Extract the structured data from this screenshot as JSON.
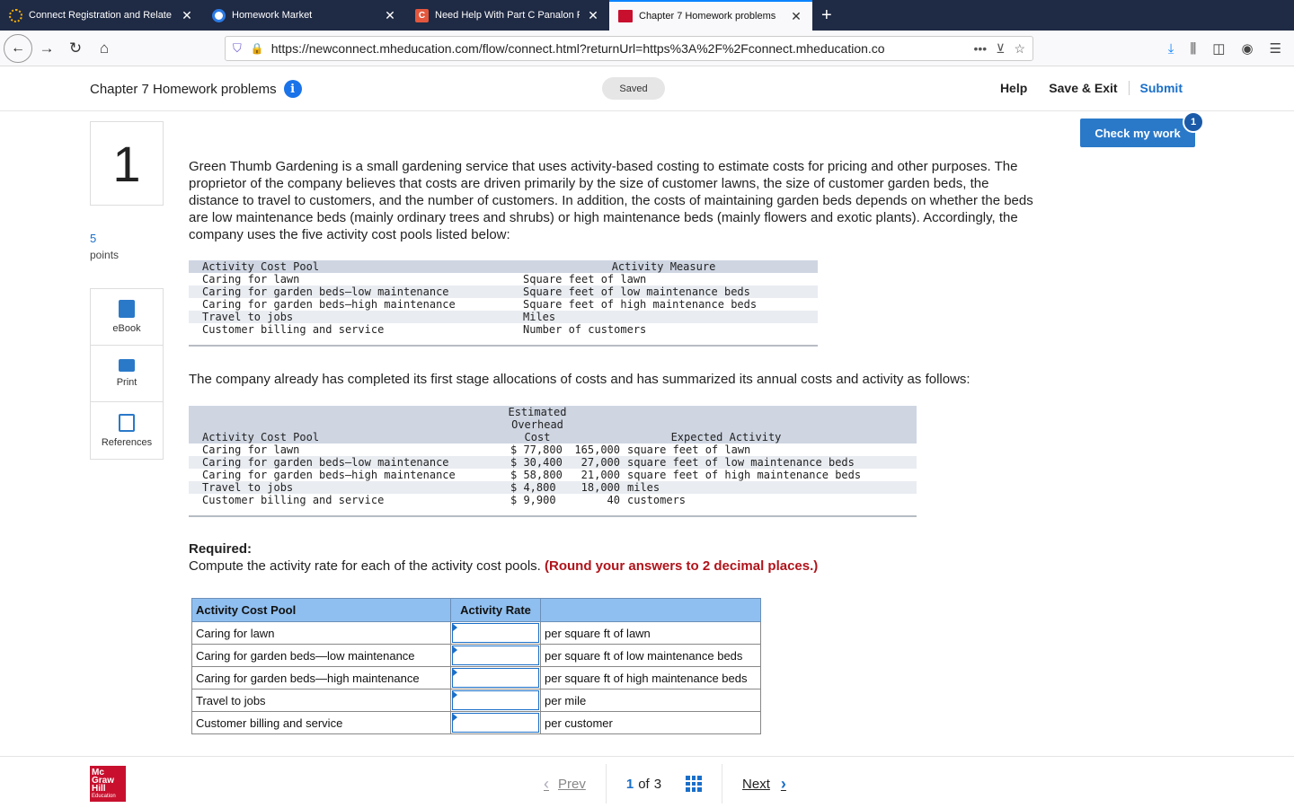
{
  "browser": {
    "tabs": [
      {
        "title": "Connect Registration and Relate",
        "active": false
      },
      {
        "title": "Homework Market",
        "active": false
      },
      {
        "title": "Need Help With Part C Panalon F",
        "active": false
      },
      {
        "title": "Chapter 7 Homework problems",
        "active": true
      }
    ],
    "new_tab": "+",
    "url": "https://newconnect.mheducation.com/flow/connect.html?returnUrl=https%3A%2F%2Fconnect.mheducation.co",
    "url_actions": "•••",
    "colors": {
      "tabstrip": "#1f2a44",
      "accent": "#0a84ff"
    }
  },
  "header": {
    "title": "Chapter 7 Homework problems",
    "info_icon": "i",
    "saved": "Saved",
    "help": "Help",
    "save_exit": "Save & Exit",
    "submit": "Submit",
    "check_my_work": "Check my work",
    "check_badge": "1"
  },
  "question": {
    "number": "1",
    "points_value": "5",
    "points_label": "points",
    "tools": [
      {
        "label": "eBook",
        "icon": "book-icon"
      },
      {
        "label": "Print",
        "icon": "print-icon"
      },
      {
        "label": "References",
        "icon": "references-icon"
      }
    ]
  },
  "content": {
    "intro": "Green Thumb Gardening is a small gardening service that uses activity-based costing to estimate costs for pricing and other purposes. The proprietor of the company believes that costs are driven primarily by the size of customer lawns, the size of customer garden beds, the distance to travel to customers, and the number of customers. In addition, the costs of maintaining garden beds depends on whether the beds are low maintenance beds (mainly ordinary trees and shrubs) or high maintenance beds (mainly flowers and exotic plants). Accordingly, the company uses the five activity cost pools listed below:",
    "pools_table": {
      "headers": [
        "Activity Cost Pool",
        "Activity Measure"
      ],
      "rows": [
        [
          "Caring for lawn",
          "Square feet of lawn"
        ],
        [
          "Caring for garden beds–low maintenance",
          "Square feet of low maintenance beds"
        ],
        [
          "Caring for garden beds–high maintenance",
          "Square feet of high maintenance beds"
        ],
        [
          "Travel to jobs",
          "Miles"
        ],
        [
          "Customer billing and service",
          "Number of customers"
        ]
      ]
    },
    "mid_text": "The company already has completed its first stage allocations of costs and has summarized its annual costs and activity as follows:",
    "cost_table": {
      "header_lines": [
        "Estimated",
        "Overhead",
        "Cost"
      ],
      "col1_header": "Activity Cost Pool",
      "col3_header": "Expected Activity",
      "rows": [
        [
          "Caring for lawn",
          "$ 77,800",
          "165,000",
          "square feet of lawn"
        ],
        [
          "Caring for garden beds–low maintenance",
          "$ 30,400",
          "27,000",
          "square feet of low maintenance beds"
        ],
        [
          "Caring for garden beds–high maintenance",
          "$ 58,800",
          "21,000",
          "square feet of high maintenance beds"
        ],
        [
          "Travel to jobs",
          "$ 4,800",
          "18,000",
          "miles"
        ],
        [
          "Customer billing and service",
          "$ 9,900",
          "40",
          "customers"
        ]
      ]
    },
    "required_heading": "Required:",
    "required_text": "Compute the activity rate for each of the activity cost pools.",
    "required_note": "(Round your answers to 2 decimal places.)"
  },
  "answer_table": {
    "headers": [
      "Activity Cost Pool",
      "Activity Rate",
      ""
    ],
    "rows": [
      {
        "pool": "Caring for lawn",
        "value": "",
        "unit": "per square ft of lawn"
      },
      {
        "pool": "Caring for garden beds—low maintenance",
        "value": "",
        "unit": "per square ft of low maintenance beds"
      },
      {
        "pool": "Caring for garden beds—high maintenance",
        "value": "",
        "unit": "per square ft of high maintenance beds"
      },
      {
        "pool": "Travel to jobs",
        "value": "",
        "unit": "per mile"
      },
      {
        "pool": "Customer billing and service",
        "value": "",
        "unit": "per customer"
      }
    ]
  },
  "footer": {
    "logo_lines": [
      "Mc",
      "Graw",
      "Hill",
      "Education"
    ],
    "prev": "Prev",
    "page_current": "1",
    "page_of": "of",
    "page_total": "3",
    "next": "Next"
  }
}
